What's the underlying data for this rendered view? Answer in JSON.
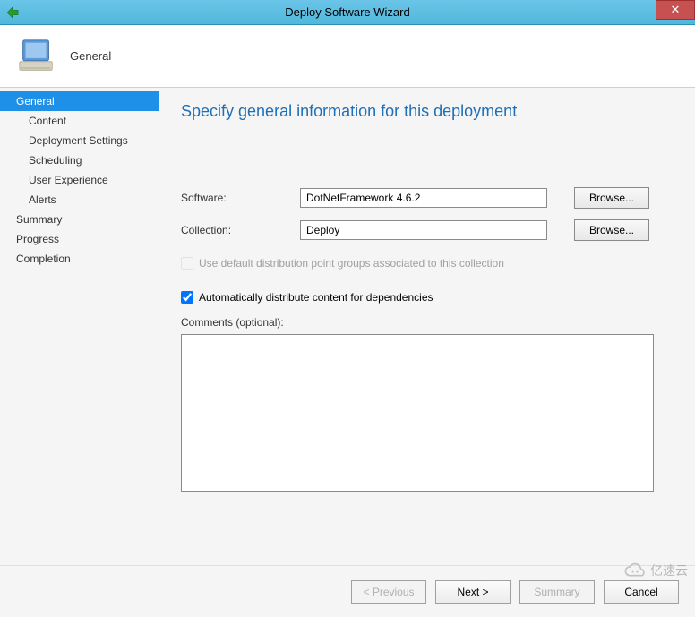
{
  "titlebar": {
    "title": "Deploy Software Wizard",
    "close_symbol": "✕"
  },
  "header": {
    "title": "General"
  },
  "nav": {
    "items": [
      {
        "label": "General",
        "indent": false,
        "selected": true
      },
      {
        "label": "Content",
        "indent": true,
        "selected": false
      },
      {
        "label": "Deployment Settings",
        "indent": true,
        "selected": false
      },
      {
        "label": "Scheduling",
        "indent": true,
        "selected": false
      },
      {
        "label": "User Experience",
        "indent": true,
        "selected": false
      },
      {
        "label": "Alerts",
        "indent": true,
        "selected": false
      },
      {
        "label": "Summary",
        "indent": false,
        "selected": false
      },
      {
        "label": "Progress",
        "indent": false,
        "selected": false
      },
      {
        "label": "Completion",
        "indent": false,
        "selected": false
      }
    ]
  },
  "content": {
    "title": "Specify general information for this deployment",
    "software_label": "Software:",
    "software_value": "DotNetFramework 4.6.2",
    "software_browse": "Browse...",
    "collection_label": "Collection:",
    "collection_value": "Deploy",
    "collection_browse": "Browse...",
    "cb_default_dist": "Use default distribution point groups associated to this collection",
    "cb_auto_dist": "Automatically distribute content for dependencies",
    "comments_label": "Comments (optional):",
    "comments_value": ""
  },
  "footer": {
    "previous": "< Previous",
    "next": "Next >",
    "summary": "Summary",
    "cancel": "Cancel"
  },
  "watermark": {
    "text": "亿速云"
  }
}
